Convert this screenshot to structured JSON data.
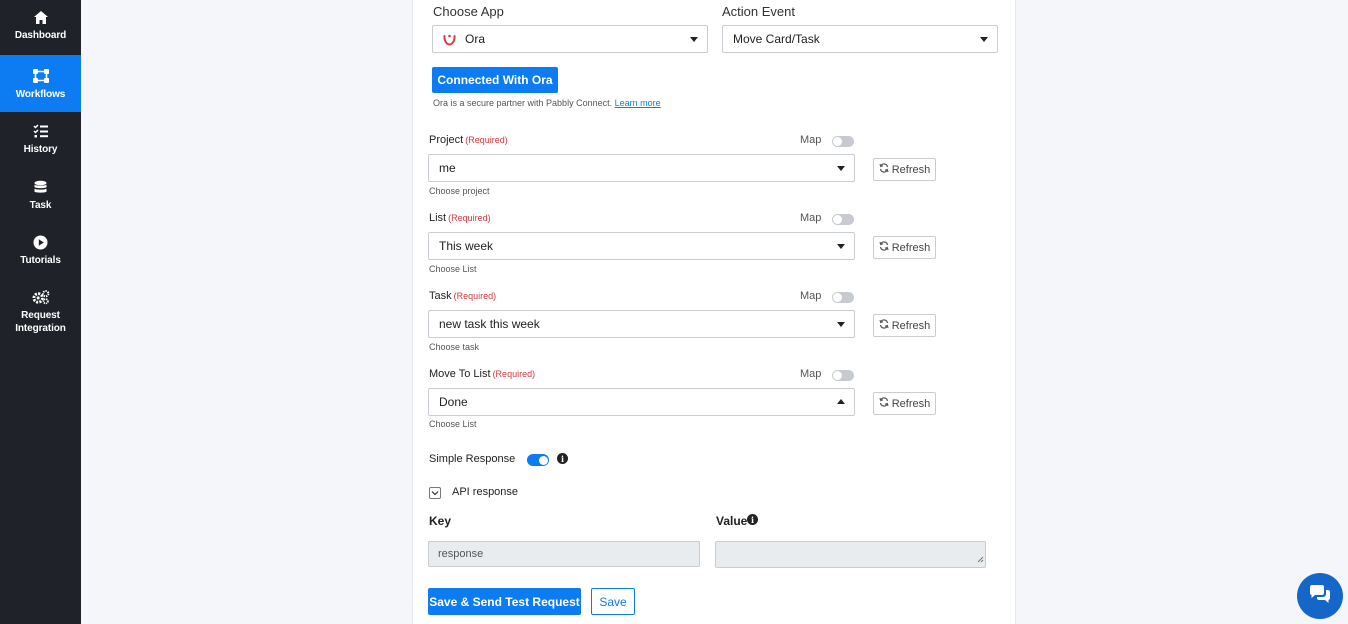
{
  "sidebar": {
    "items": [
      {
        "label": "Dashboard",
        "icon": "home-icon",
        "active": false
      },
      {
        "label": "Workflows",
        "icon": "workflow-icon",
        "active": true
      },
      {
        "label": "History",
        "icon": "list-check-icon",
        "active": false
      },
      {
        "label": "Task",
        "icon": "database-stack-icon",
        "active": false
      },
      {
        "label": "Tutorials",
        "icon": "play-circle-icon",
        "active": false
      },
      {
        "label": "Request Integration",
        "icon": "gears-icon",
        "active": false
      }
    ]
  },
  "action": {
    "choose_app_label": "Choose App",
    "app_value": "Ora",
    "action_event_label": "Action Event",
    "action_event_value": "Move Card/Task",
    "connected_button": "Connected With Ora",
    "secure_note": "Ora is a secure partner with Pabbly Connect.",
    "learn_more": "Learn more"
  },
  "fields": [
    {
      "label": "Project",
      "required": "(Required)",
      "map_label": "Map",
      "value": "me",
      "helper": "Choose project",
      "refresh": "Refresh",
      "open": false
    },
    {
      "label": "List",
      "required": "(Required)",
      "map_label": "Map",
      "value": "This week",
      "helper": "Choose List",
      "refresh": "Refresh",
      "open": false
    },
    {
      "label": "Task",
      "required": "(Required)",
      "map_label": "Map",
      "value": "new task this week",
      "helper": "Choose task",
      "refresh": "Refresh",
      "open": false
    },
    {
      "label": "Move To List",
      "required": "(Required)",
      "map_label": "Map",
      "value": "Done",
      "helper": "Choose List",
      "refresh": "Refresh",
      "open": true
    }
  ],
  "simple_response": {
    "label": "Simple Response",
    "enabled": true
  },
  "api_response": {
    "label": "API response",
    "expanded": true
  },
  "kv": {
    "key_label": "Key",
    "value_label": "Value",
    "key_value": "response",
    "value_value": ""
  },
  "buttons": {
    "save_send": "Save & Send Test Request",
    "save": "Save"
  },
  "colors": {
    "accent": "#0d7cf2",
    "sidebar_bg": "#1f2229",
    "required": "#d9363e",
    "chat": "#1466c8"
  }
}
